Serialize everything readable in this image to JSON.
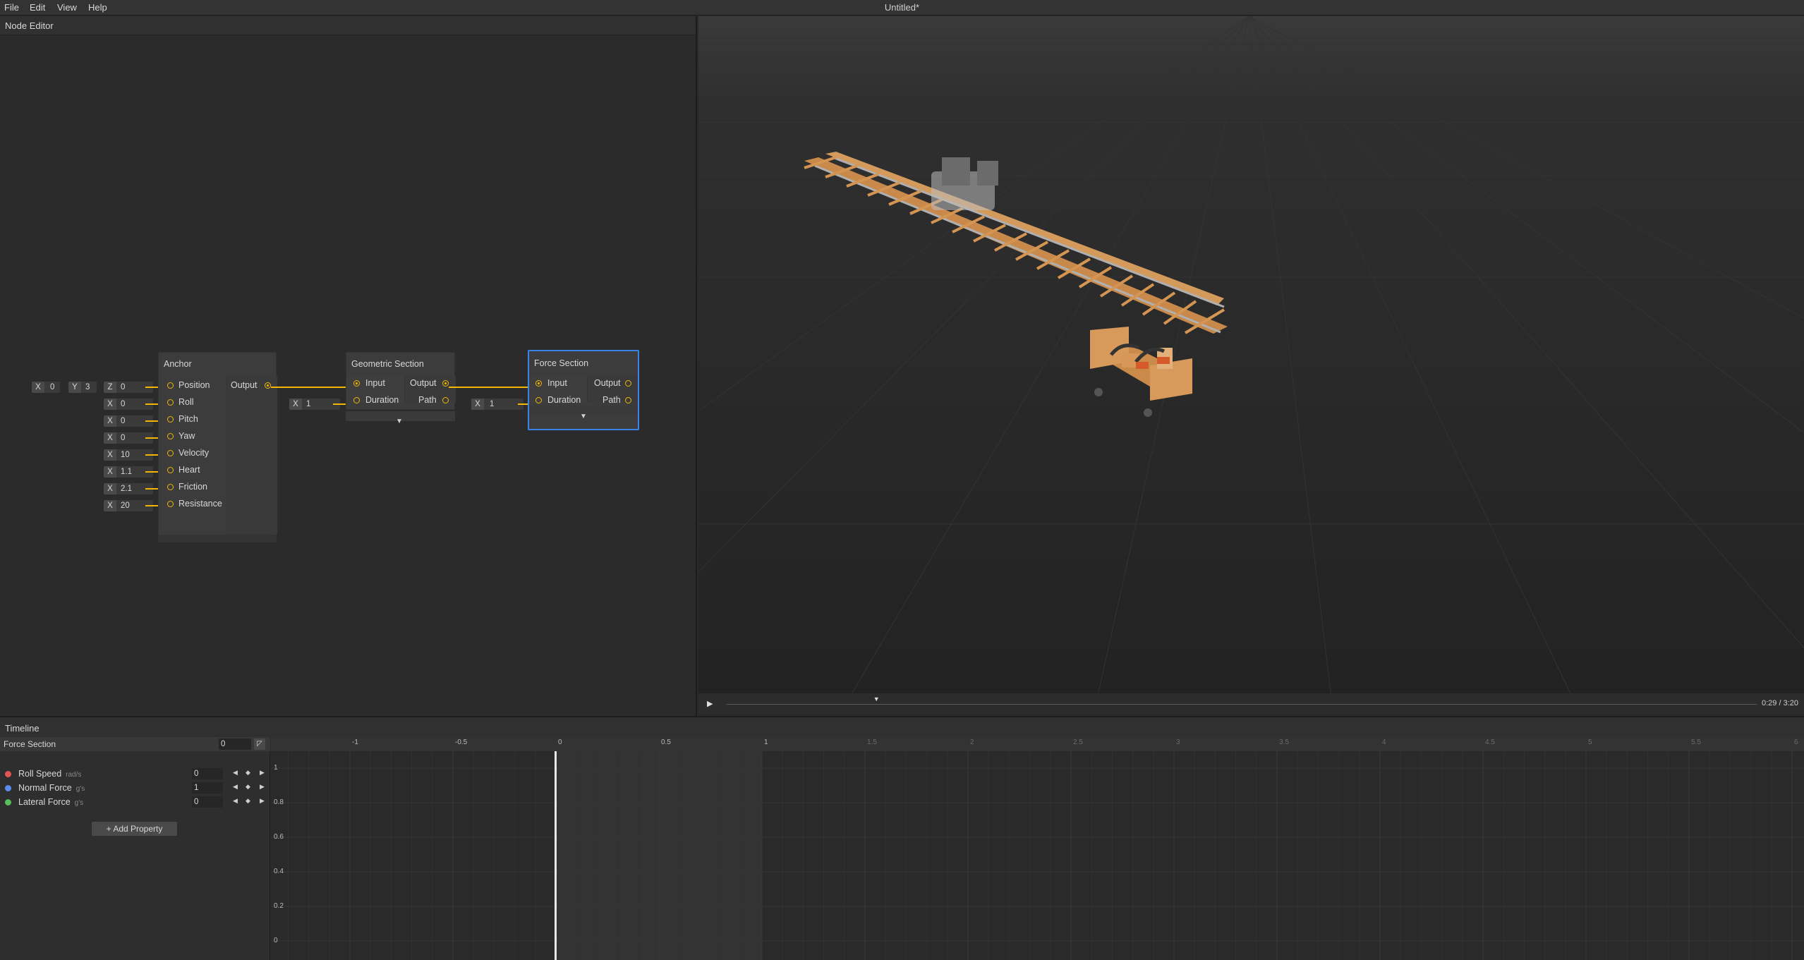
{
  "menu": {
    "file": "File",
    "edit": "Edit",
    "view": "View",
    "help": "Help"
  },
  "window_title": "Untitled*",
  "node_editor": {
    "title": "Node Editor",
    "anchor": {
      "title": "Anchor",
      "output_label": "Output",
      "position": {
        "label": "Position",
        "x_axis": "X",
        "x": "0",
        "y_axis": "Y",
        "y": "3",
        "z_axis": "Z",
        "z": "0"
      },
      "inputs": [
        {
          "label": "Roll",
          "axis": "X",
          "value": "0"
        },
        {
          "label": "Pitch",
          "axis": "X",
          "value": "0"
        },
        {
          "label": "Yaw",
          "axis": "X",
          "value": "0"
        },
        {
          "label": "Velocity",
          "axis": "X",
          "value": "10"
        },
        {
          "label": "Heart",
          "axis": "X",
          "value": "1.1"
        },
        {
          "label": "Friction",
          "axis": "X",
          "value": "2.1"
        },
        {
          "label": "Resistance",
          "axis": "X",
          "value": "20"
        }
      ]
    },
    "geometric": {
      "title": "Geometric Section",
      "input_label": "Input",
      "duration_label": "Duration",
      "output_label": "Output",
      "path_label": "Path",
      "duration_axis": "X",
      "duration_value": "1"
    },
    "force": {
      "title": "Force Section",
      "input_label": "Input",
      "duration_label": "Duration",
      "output_label": "Output",
      "path_label": "Path",
      "duration_axis": "X",
      "duration_value": "1"
    }
  },
  "viewport": {
    "play_icon": "play-icon",
    "time": "0:29 / 3:20",
    "progress": 0.145
  },
  "timeline": {
    "title": "Timeline",
    "section_label": "Force Section",
    "section_value": "0",
    "properties": [
      {
        "name": "Roll Speed",
        "unit": "rad/s",
        "value": "0",
        "color": "#e05555"
      },
      {
        "name": "Normal Force",
        "unit": "g's",
        "value": "1",
        "color": "#5b8def"
      },
      {
        "name": "Lateral Force",
        "unit": "g's",
        "value": "0",
        "color": "#55c055"
      }
    ],
    "add_property": "+ Add Property",
    "ruler_labels": [
      "-1",
      "-0.5",
      "0",
      "0.5",
      "1",
      "1.5",
      "2",
      "2.5",
      "3",
      "3.5",
      "4",
      "4.5",
      "5",
      "5.5",
      "6"
    ],
    "y_ticks": [
      "1",
      "0.8",
      "0.6",
      "0.4",
      "0.2",
      "0"
    ],
    "playhead": 0
  }
}
